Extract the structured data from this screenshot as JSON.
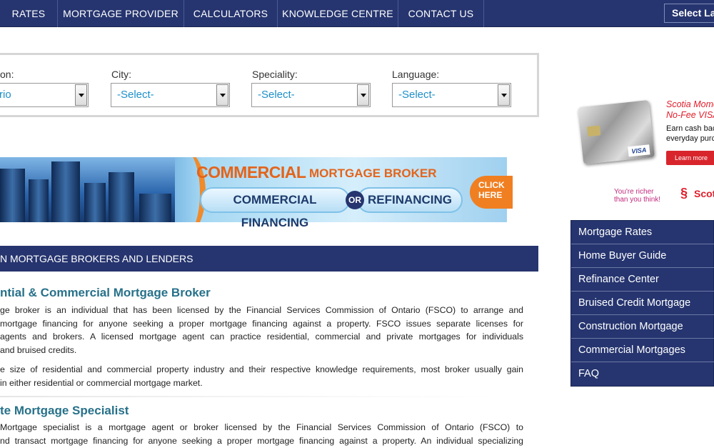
{
  "nav": {
    "items": [
      "RATES",
      "MORTGAGE PROVIDER",
      "CALCULATORS",
      "KNOWLEDGE CENTRE",
      "CONTACT US"
    ],
    "language_select": "Select La"
  },
  "search": {
    "fields": [
      {
        "label": "on:",
        "value": "rio"
      },
      {
        "label": "City:",
        "value": "-Select-"
      },
      {
        "label": "Speciality:",
        "value": "-Select-"
      },
      {
        "label": "Language:",
        "value": "-Select-"
      }
    ]
  },
  "banner": {
    "title_big": "COMMERCIAL",
    "title_rest": "MORTGAGE BROKER",
    "pill_left": "COMMERCIAL FINANCING",
    "or": "OR",
    "pill_right": "REFINANCING",
    "cta_line1": "CLICK",
    "cta_line2": "HERE"
  },
  "section": {
    "header": "N MORTGAGE BROKERS AND LENDERS",
    "heading1": "ntial & Commercial Mortgage Broker",
    "para1_lines": [
      "ge broker is an individual that has been licensed by the Financial Services Commission of Ontario (FSCO) to arrange and",
      "mortgage financing for anyone seeking a proper mortgage financing against a property. FSCO issues separate licenses for",
      "agents and brokers. A licensed mortgage agent can practice residential, commercial and private mortgages for individuals",
      "and bruised credits."
    ],
    "para2_lines": [
      "e size of residential and commercial property industry and their respective knowledge requirements, most broker usually gain",
      "in either residential or commercial mortgage market."
    ],
    "heading2": "te Mortgage Specialist",
    "para3_lines": [
      "Mortgage specialist is a mortgage agent or broker licensed by the Financial Services Commission of Ontario (FSCO) to",
      "nd transact mortgage financing for anyone seeking a proper mortgage financing against a property. An individual specializing"
    ]
  },
  "ad": {
    "title_line1": "Scotia Mome",
    "title_line2": "No-Fee VISA",
    "text_line1": "Earn cash bac",
    "text_line2": "everyday purc",
    "button": "Learn more",
    "slogan_line1": "You're richer",
    "slogan_line2": "than you think!",
    "brand": "Scot",
    "card_visa": "VISA"
  },
  "sidebar": {
    "items": [
      "Mortgage Rates",
      "Home Buyer Guide",
      "Refinance Center",
      "Bruised Credit Mortgage",
      "Construction Mortgage",
      "Commercial Mortgages",
      "FAQ"
    ]
  }
}
